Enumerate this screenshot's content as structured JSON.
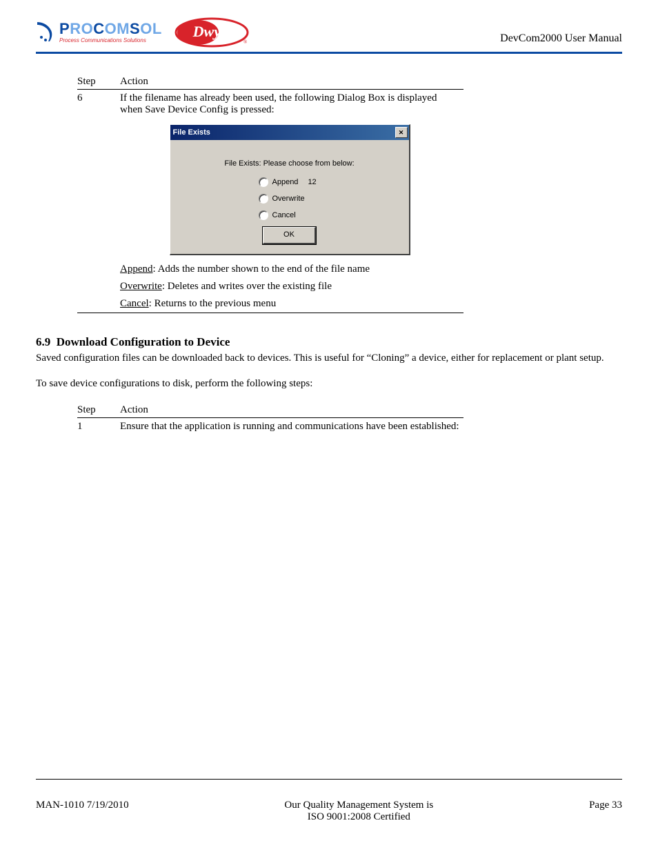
{
  "header": {
    "procomsol": {
      "name_parts": {
        "p": "P",
        "ro": "RO",
        "c": "C",
        "om": "OM",
        "s": "S",
        "ol": "OL"
      },
      "tagline": "Process Communications Solutions"
    },
    "title": "DevCom2000 User Manual"
  },
  "table1": {
    "headers": {
      "step": "Step",
      "action": "Action"
    },
    "step_num": "6",
    "intro": "If the filename has already been used, the following Dialog Box is displayed when Save Device Config is pressed:",
    "explain": [
      {
        "term": "Append",
        "desc": ": Adds the number shown to the end of the file name"
      },
      {
        "term": "Overwrite",
        "desc": ": Deletes and writes over the existing file"
      },
      {
        "term": "Cancel",
        "desc": ": Returns to the previous menu"
      }
    ]
  },
  "dialog": {
    "title": "File Exists",
    "message": "File Exists: Please choose from below:",
    "options": {
      "append": {
        "label": "Append",
        "suffix": "12"
      },
      "overwrite": {
        "label": "Overwrite"
      },
      "cancel": {
        "label": "Cancel"
      }
    },
    "ok": "OK"
  },
  "section": {
    "number": "6.9",
    "title": "Download Configuration to Device",
    "para1": "Saved configuration files can be downloaded back to devices.  This is useful for “Cloning” a device, either for replacement or plant setup.",
    "para2": "To save device configurations to disk, perform the following steps:"
  },
  "table2": {
    "headers": {
      "step": "Step",
      "action": "Action"
    },
    "step_num": "1",
    "text": "Ensure that the application is running and communications have been established:"
  },
  "footer": {
    "left": "MAN-1010 7/19/2010",
    "center1": "Our Quality Management System is",
    "center2": "ISO 9001:2008 Certified",
    "right": "Page 33"
  }
}
